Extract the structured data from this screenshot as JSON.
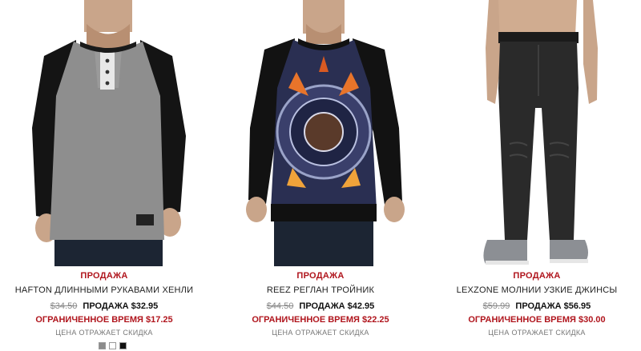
{
  "products": [
    {
      "sale_tag": "ПРОДАЖА",
      "title": "HAFTON ДЛИННЫМИ РУКАВАМИ ХЕНЛИ",
      "old_price": "$34.50",
      "sale_price": "ПРОДАЖА $32.95",
      "limited": "ОГРАНИЧЕННОЕ ВРЕМЯ $17.25",
      "note": "ЦЕНА ОТРАЖАЕТ СКИДКА",
      "swatches": [
        {
          "name": "grey",
          "color": "#8c8c8c"
        },
        {
          "name": "white",
          "color": "#ffffff"
        },
        {
          "name": "black",
          "color": "#111111"
        }
      ]
    },
    {
      "sale_tag": "ПРОДАЖА",
      "title": "REEZ РЕГЛАН ТРОЙНИК",
      "old_price": "$44.50",
      "sale_price": "ПРОДАЖА $42.95",
      "limited": "ОГРАНИЧЕННОЕ ВРЕМЯ $22.25",
      "note": "ЦЕНА ОТРАЖАЕТ СКИДКА"
    },
    {
      "sale_tag": "ПРОДАЖА",
      "title": "LEXZONE МОЛНИИ УЗКИЕ ДЖИНСЫ",
      "old_price": "$59.99",
      "sale_price": "ПРОДАЖА $56.95",
      "limited": "ОГРАНИЧЕННОЕ ВРЕМЯ $30.00",
      "note": "ЦЕНА ОТРАЖАЕТ СКИДКА"
    }
  ],
  "colors": {
    "sale_red": "#b0151d",
    "text_dark": "#111111",
    "text_muted": "#888888"
  }
}
